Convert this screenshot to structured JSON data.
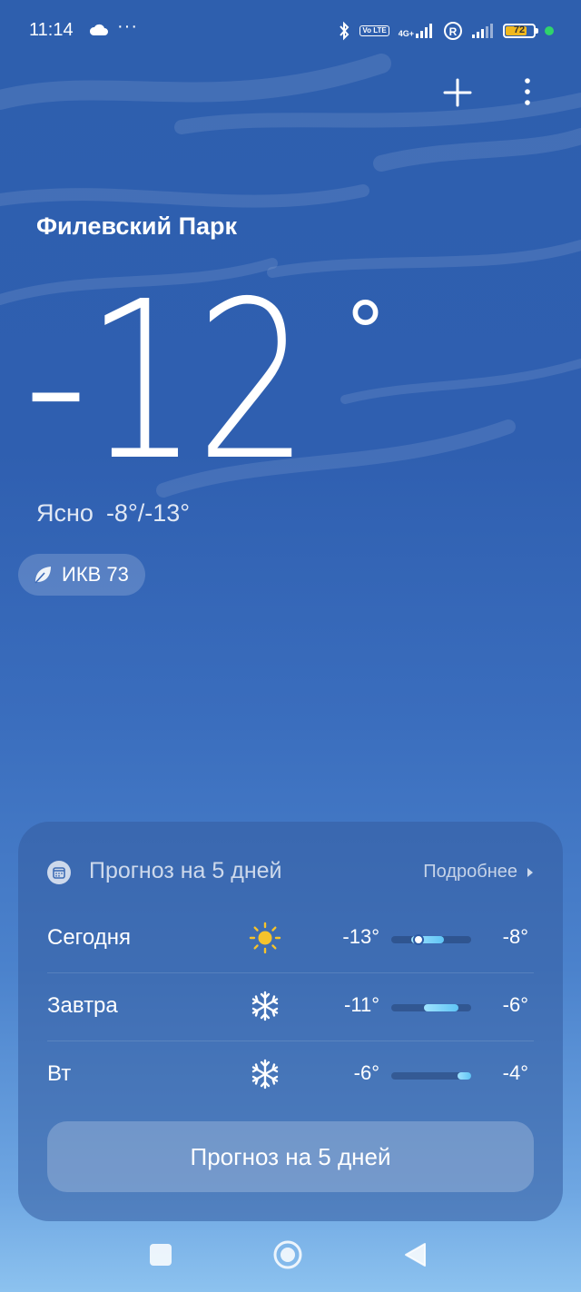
{
  "status_bar": {
    "time": "11:14",
    "dots": "···",
    "volte": "Vo LTE",
    "network": "4G+",
    "battery": "72",
    "battery_color": "#f0b81e"
  },
  "header": {
    "add_icon": "plus-icon",
    "menu_icon": "more-vertical-icon"
  },
  "current": {
    "location": "Филевский Парк",
    "temperature": "-12",
    "unit": "°",
    "condition": "Ясно",
    "range": "-8°/-13°",
    "aqi": "ИКВ 73"
  },
  "forecast_card": {
    "title": "Прогноз на 5 дней",
    "more_label": "Подробнее",
    "rows": [
      {
        "day": "Сегодня",
        "icon": "sun-icon",
        "min": "-13°",
        "max": "-8°"
      },
      {
        "day": "Завтра",
        "icon": "snowflake-icon",
        "min": "-11°",
        "max": "-6°"
      },
      {
        "day": "Вт",
        "icon": "snowflake-icon",
        "min": "-6°",
        "max": "-4°"
      }
    ],
    "button_label": "Прогноз на 5 дней"
  },
  "colors": {
    "sun": "#f5c32c",
    "bar": "#5fc4f5"
  }
}
